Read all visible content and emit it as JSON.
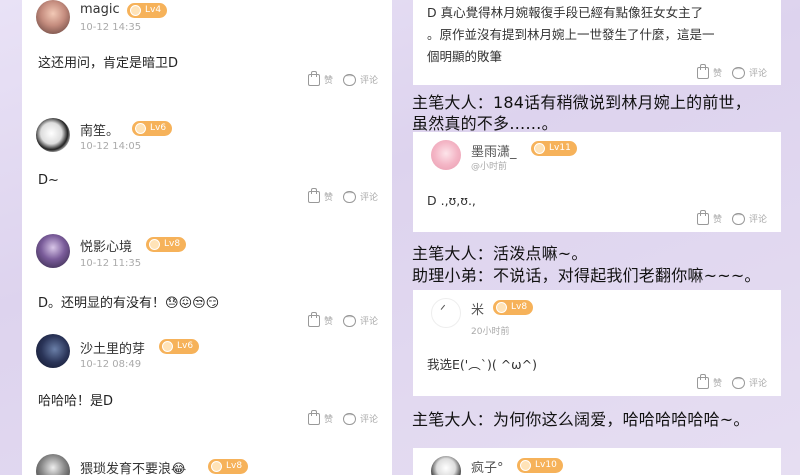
{
  "left_comments": [
    {
      "username": "magic",
      "level": "Lv4",
      "time": "10-12 14:35",
      "text": "这还用问，肯定是暗卫D",
      "like_label": "赞",
      "reply_label": "评论"
    },
    {
      "username": "南笙。",
      "level": "Lv6",
      "time": "10-12 14:05",
      "text": "D~",
      "like_label": "赞",
      "reply_label": "评论"
    },
    {
      "username": "悦影心境",
      "level": "Lv8",
      "time": "10-12 11:35",
      "text": "D。还明显的有没有！😓😖😒😏",
      "like_label": "赞",
      "reply_label": "评论"
    },
    {
      "username": "沙土里的芽",
      "level": "Lv6",
      "time": "10-12 08:49",
      "text": "哈哈哈！是D",
      "like_label": "赞",
      "reply_label": "评论"
    },
    {
      "username": "猥琐发育不要浪😂",
      "level": "Lv8"
    }
  ],
  "right_top_card": {
    "line1": "D 真心覺得林月婉報復手段已經有點像狂女女主了",
    "line2": "。原作並沒有提到林月婉上一世發生了什麼，這是一",
    "line3": "個明顯的敗筆",
    "like_label": "赞",
    "reply_label": "评论"
  },
  "captions": [
    "主笔大人：184话有稍微说到林月婉上的前世，",
    "虽然真的不多……。",
    "主笔大人：活泼点嘛~。",
    "助理小弟：不说话，对得起我们老翻你嘛~~~。",
    "主笔大人：为何你这么阔爱，哈哈哈哈哈哈~。"
  ],
  "right_comments": [
    {
      "username": "墨雨潇_",
      "level": "Lv11",
      "time": "@小时前",
      "text": "D .,ʊ,ʊ.,",
      "like_label": "赞",
      "reply_label": "评论"
    },
    {
      "username": "米",
      "level": "Lv8",
      "time": "20小时前",
      "text": "我选E('︵`)( ^ω^)",
      "like_label": "赞",
      "reply_label": "评论"
    },
    {
      "username": "疯子°",
      "level": "Lv10"
    }
  ],
  "colors": {
    "badge": "#f6b25a",
    "background": "#e4dcf1",
    "panel": "#ffffff"
  }
}
